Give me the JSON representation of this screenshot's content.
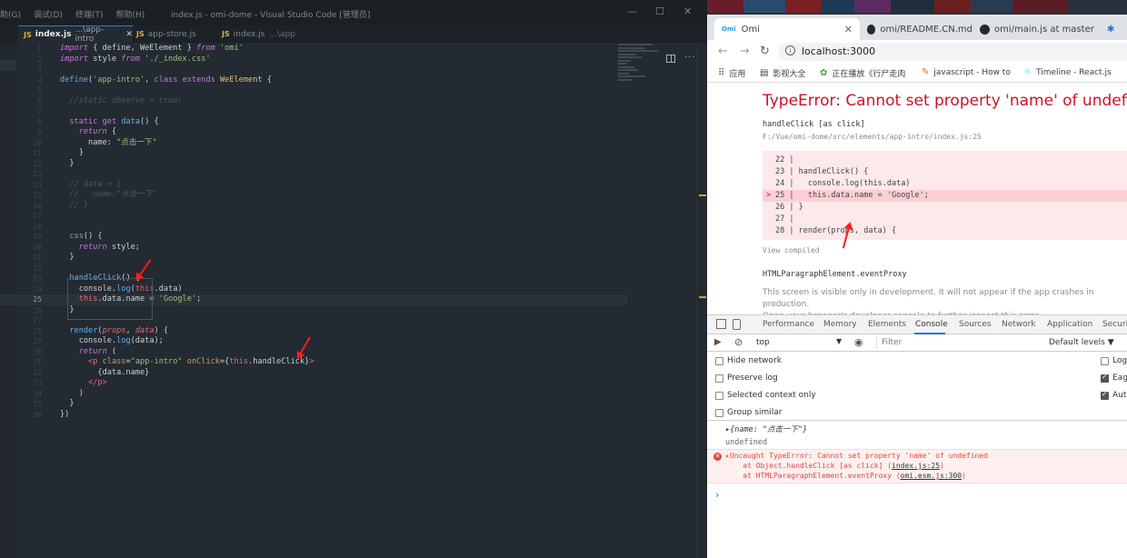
{
  "vscode": {
    "menu": [
      "助(G)",
      "调试(D)",
      "终端(T)",
      "帮助(H)"
    ],
    "window_title": "index.js - omi-dome - Visual Studio Code [管理员]",
    "window_buttons": [
      "—",
      "☐",
      "✕"
    ],
    "tabs": [
      {
        "name": "index.js",
        "path": "...\\app-intro",
        "close": "✕",
        "icon": "JS"
      },
      {
        "name": "app-store.js",
        "path": "",
        "icon": "JS"
      },
      {
        "name": "index.js",
        "path": "...\\app",
        "icon": "JS"
      }
    ],
    "active_line_number": "25",
    "lines": [
      "import { define, WeElement } from 'omi'",
      "import style from './_index.css'",
      "",
      "define('app-intro', class extends WeElement {",
      "",
      "  //static observe = true;",
      "",
      "  static get data() {",
      "    return {",
      "      name: \"点击一下\"",
      "    }",
      "  }",
      "",
      "  // data = {",
      "  //   name:\"点击一下\"",
      "  // }",
      "",
      "",
      "  css() {",
      "    return style;",
      "  }",
      "",
      "  handleClick() {",
      "    console.log(this.data)",
      "    this.data.name = 'Google';",
      "  }",
      "",
      "  render(props, data) {",
      "    console.log(data);",
      "    return (",
      "      <p class=\"app-intro\" onClick={this.handleClick}>",
      "        {data.name}",
      "      </p>",
      "    )",
      "  }",
      "})"
    ]
  },
  "chrome": {
    "tabs": [
      {
        "title": "Omi",
        "icon": "omi-icon",
        "close": "✕"
      },
      {
        "title": "omi/README.CN.md",
        "icon": "github-icon"
      },
      {
        "title": "omi/main.js at master",
        "icon": "github-icon"
      }
    ],
    "url": "localhost:3000",
    "info_icon": "i",
    "bookmarks": [
      {
        "icon": "⠿",
        "label": "应用"
      },
      {
        "icon": "▤",
        "label": "影视大全"
      },
      {
        "icon": "✿",
        "label": "正在播放《行尸走肉"
      },
      {
        "icon": "✎",
        "label": "javascript - How to"
      },
      {
        "icon": "⚛",
        "label": "Timeline - React.js"
      }
    ],
    "error_overlay": {
      "title": "TypeError: Cannot set property 'name' of undefined",
      "handler": "handleClick [as click]",
      "path": "F:/Vue/omi-dome/src/elements/app-intro/index.js:25",
      "code_lines": [
        {
          "num": "22",
          "text": "|"
        },
        {
          "num": "23",
          "text": "| handleClick() {"
        },
        {
          "num": "24",
          "text": "|   console.log(this.data)"
        },
        {
          "num": "25",
          "text": "|   this.data.name = 'Google';",
          "marker": ">"
        },
        {
          "num": "26",
          "text": "| }"
        },
        {
          "num": "27",
          "text": "|"
        },
        {
          "num": "28",
          "text": "| render(props, data) {"
        }
      ],
      "view_compiled": "View compiled",
      "proxy": "HTMLParagraphElement.eventProxy",
      "note_line1": "This screen is visible only in development. It will not appear if the app crashes in production.",
      "note_line2": "Open your browser's developer console to further inspect this error."
    },
    "devtools": {
      "tabs": [
        "Performance",
        "Memory",
        "Elements",
        "Console",
        "Sources",
        "Network",
        "Application",
        "Securit"
      ],
      "active_tab": "Console",
      "context": "top",
      "filter_placeholder": "Filter",
      "levels": "Default levels ▼",
      "settings_left": [
        "Hide network",
        "Preserve log",
        "Selected context only",
        "Group similar"
      ],
      "settings_right": [
        {
          "label": "Log",
          "checked": false
        },
        {
          "label": "Eag",
          "checked": true
        },
        {
          "label": "Aut",
          "checked": true
        }
      ],
      "console_lines": {
        "object": "▸{name: \"点击一下\"}",
        "undefined": "undefined",
        "error_icon": "✕",
        "error_main": "▸Uncaught TypeError: Cannot set property 'name' of undefined",
        "error_at1_pre": "    at Object.handleClick [as click] (",
        "error_at1_link": "index.js:25",
        "error_at1_post": ")",
        "error_at2_pre": "    at HTMLParagraphElement.eventProxy (",
        "error_at2_link": "omi.esm.js:300",
        "error_at2_post": ")",
        "prompt": "›"
      }
    }
  }
}
